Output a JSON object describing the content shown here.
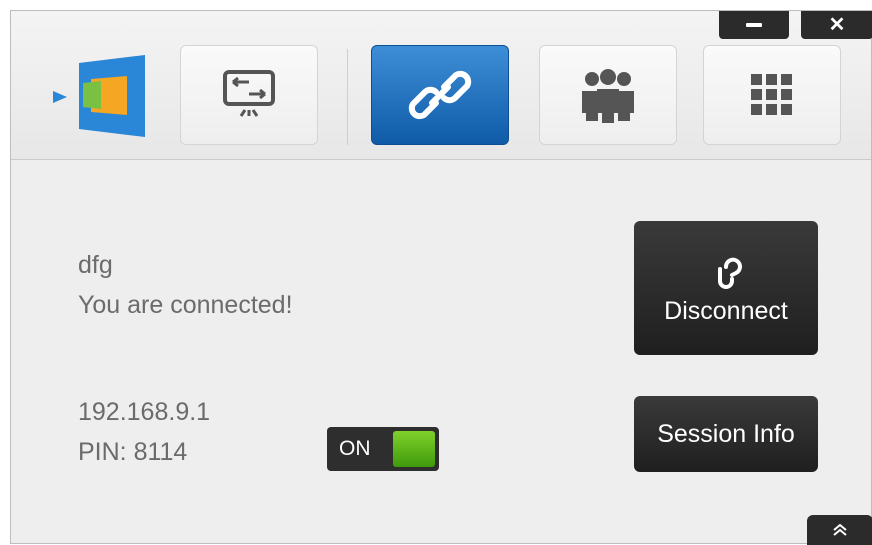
{
  "window_controls": {
    "minimize_icon": "minimize-icon",
    "close_icon": "close-icon"
  },
  "toolbar": {
    "logo_icon": "app-logo-icon",
    "buttons": [
      {
        "name": "screen-share",
        "icon": "screen-share-icon"
      },
      {
        "name": "connect",
        "icon": "link-icon",
        "active": true
      },
      {
        "name": "participants",
        "icon": "group-icon"
      },
      {
        "name": "apps",
        "icon": "grid-icon"
      }
    ]
  },
  "connection": {
    "name": "dfg",
    "status": "You are connected!",
    "ip": "192.168.9.1",
    "pin": "PIN: 8114"
  },
  "toggle": {
    "label": "ON",
    "state": true,
    "accent": "#5bb61a"
  },
  "actions": {
    "disconnect": "Disconnect",
    "session_info": "Session Info"
  },
  "colors": {
    "active_tab": "#1f6fbd",
    "dark_button": "#262626",
    "text": "#6b6b6b"
  }
}
